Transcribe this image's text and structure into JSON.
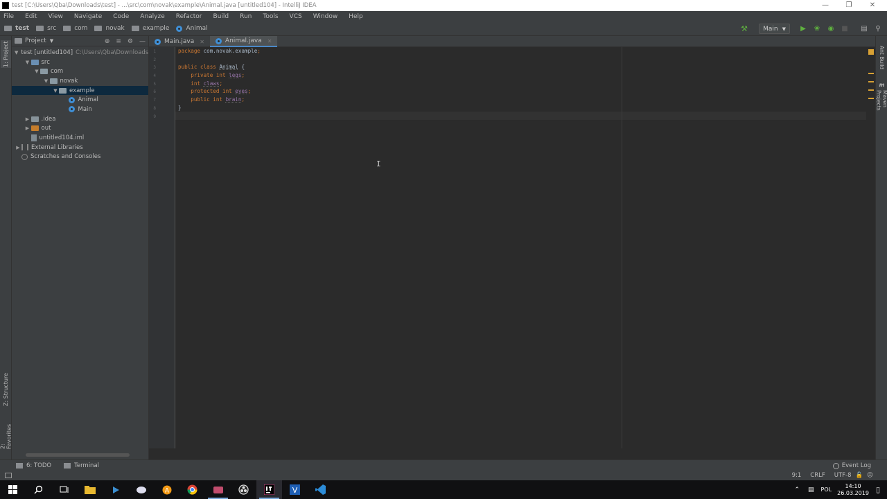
{
  "window": {
    "title": "test [C:\\Users\\Qba\\Downloads\\test] - ...\\src\\com\\novak\\example\\Animal.java [untitled104] - IntelliJ IDEA",
    "controls": [
      "minimize-icon",
      "maximize-icon",
      "close-icon"
    ]
  },
  "menu": [
    "File",
    "Edit",
    "View",
    "Navigate",
    "Code",
    "Analyze",
    "Refactor",
    "Build",
    "Run",
    "Tools",
    "VCS",
    "Window",
    "Help"
  ],
  "breadcrumbs": [
    "test",
    "src",
    "com",
    "novak",
    "example",
    "Animal"
  ],
  "toolbar": {
    "run_config": "Main",
    "icons": [
      "hammer-icon",
      "run-icon",
      "debug-icon",
      "coverage-icon",
      "stop-icon",
      "project-structure-icon",
      "search-everywhere-icon"
    ]
  },
  "left_strip": {
    "project_tab": "1: Project",
    "structure_tab": "Z: Structure",
    "favorites_tab": "2: Favorites"
  },
  "project_panel": {
    "title": "Project",
    "tree": [
      {
        "label": "test [untitled104]",
        "suffix": "C:\\Users\\Qba\\Downloads\\test",
        "indent": 0,
        "arrow": "open",
        "icon": "folder"
      },
      {
        "label": "src",
        "indent": 1,
        "arrow": "open",
        "icon": "folder-src"
      },
      {
        "label": "com",
        "indent": 2,
        "arrow": "open",
        "icon": "package"
      },
      {
        "label": "novak",
        "indent": 3,
        "arrow": "open",
        "icon": "package"
      },
      {
        "label": "example",
        "indent": 4,
        "arrow": "open",
        "icon": "package",
        "selected": true
      },
      {
        "label": "Animal",
        "indent": 5,
        "arrow": "none",
        "icon": "class"
      },
      {
        "label": "Main",
        "indent": 5,
        "arrow": "none",
        "icon": "class"
      },
      {
        "label": ".idea",
        "indent": 1,
        "arrow": "closed",
        "icon": "folder"
      },
      {
        "label": "out",
        "indent": 1,
        "arrow": "closed",
        "icon": "folder-orange"
      },
      {
        "label": "untitled104.iml",
        "indent": 1,
        "arrow": "none",
        "icon": "iml"
      },
      {
        "label": "External Libraries",
        "indent": 0,
        "arrow": "closed",
        "icon": "library"
      },
      {
        "label": "Scratches and Consoles",
        "indent": 0,
        "arrow": "none",
        "icon": "scratch"
      }
    ]
  },
  "tabs": [
    {
      "label": "Main.java",
      "active": false
    },
    {
      "label": "Animal.java",
      "active": true
    }
  ],
  "editor": {
    "line_numbers": [
      "1",
      "2",
      "3",
      "4",
      "5",
      "6",
      "7",
      "8",
      "9"
    ],
    "lines": [
      [
        {
          "t": "package ",
          "c": "kw"
        },
        {
          "t": "com.novak.example",
          "c": "plain"
        },
        {
          "t": ";",
          "c": "semi"
        }
      ],
      [],
      [
        {
          "t": "public class ",
          "c": "kw"
        },
        {
          "t": "Animal",
          "c": "cls"
        },
        {
          "t": " {",
          "c": "plain"
        }
      ],
      [
        {
          "t": "    private int ",
          "c": "kw"
        },
        {
          "t": "legs",
          "c": "fld"
        },
        {
          "t": ";",
          "c": "semi"
        }
      ],
      [
        {
          "t": "    int ",
          "c": "kw"
        },
        {
          "t": "claws",
          "c": "fld"
        },
        {
          "t": ";",
          "c": "semi"
        }
      ],
      [
        {
          "t": "    protected int ",
          "c": "kw"
        },
        {
          "t": "eyes",
          "c": "fld"
        },
        {
          "t": ";",
          "c": "semi"
        }
      ],
      [
        {
          "t": "    public int ",
          "c": "kw"
        },
        {
          "t": "brain",
          "c": "fld"
        },
        {
          "t": ";",
          "c": "semi"
        }
      ],
      [
        {
          "t": "}",
          "c": "plain"
        }
      ],
      []
    ]
  },
  "right_strip": {
    "ant_build": "Ant Build",
    "maven_projects": "Maven Projects"
  },
  "bottom_tabs": {
    "todo": "6: TODO",
    "terminal": "Terminal",
    "event_log": "Event Log"
  },
  "status": {
    "position": "9:1",
    "line_separator": "CRLF",
    "encoding": "UTF-8"
  },
  "taskbar": {
    "apps": [
      "windows-start-icon",
      "search-icon",
      "task-view-icon",
      "file-explorer-icon",
      "visual-studio-icon",
      "app-icon",
      "avast-icon",
      "chrome-icon",
      "app-icon",
      "obs-icon",
      "intellij-icon",
      "visio-icon",
      "vscode-icon"
    ],
    "language": "POL",
    "time": "14:10",
    "date": "26.03.2019"
  },
  "colors": {
    "accent": "#4a88c7",
    "keyword": "#cc7832",
    "field": "#9876aa",
    "run_green": "#5fb13f",
    "selection": "#0d293e"
  }
}
